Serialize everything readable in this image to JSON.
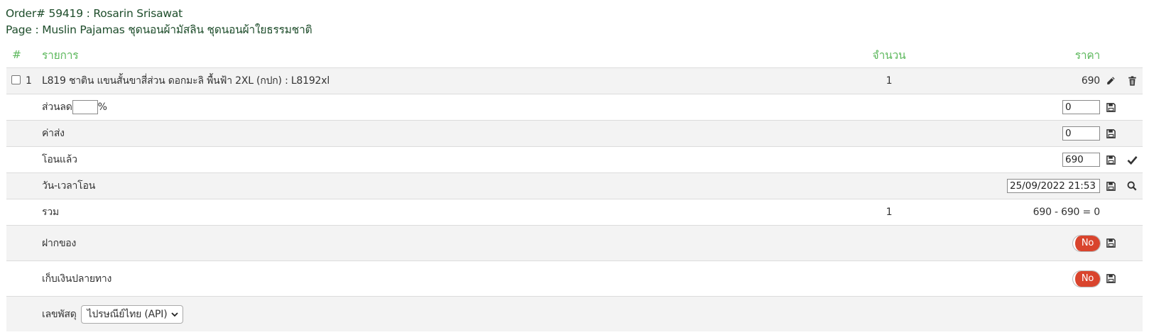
{
  "header": {
    "order_line": "Order# 59419 : Rosarin Srisawat",
    "page_line": "Page : Muslin Pajamas ชุดนอนผ้ามัสลิน ชุดนอนผ้าใยธรรมชาติ"
  },
  "columns": {
    "num": "#",
    "item": "รายการ",
    "qty": "จำนวน",
    "price": "ราคา"
  },
  "item": {
    "number": "1",
    "name": "L819 ชาติน แขนสั้นขาสี่ส่วน ดอกมะลิ พื้นฟ้า 2XL (กปก) : L8192xl",
    "qty": "1",
    "price": "690"
  },
  "discount": {
    "label": "ส่วนลด",
    "value": "",
    "unit": "%",
    "amount": "0"
  },
  "shipping": {
    "label": "ค่าส่ง",
    "value": "0"
  },
  "transferred": {
    "label": "โอนแล้ว",
    "value": "690"
  },
  "transfer_datetime": {
    "label": "วัน-เวลาโอน",
    "value": "25/09/2022 21:53"
  },
  "total": {
    "label": "รวม",
    "qty": "1",
    "formula": "690 - 690 = 0"
  },
  "deposit": {
    "label": "ฝากของ",
    "toggle": "No"
  },
  "cod": {
    "label": "เก็บเงินปลายทาง",
    "toggle": "No"
  },
  "tracking": {
    "label": "เลขพัสดุ",
    "carrier_selected": "ไปรษณีย์ไทย (API)"
  },
  "colors": {
    "header_text": "#1e4d2b",
    "column_header": "#5cb85c",
    "toggle_off": "#d9442d",
    "row_alt": "#f3f3f3"
  },
  "icons": [
    "pencil-icon",
    "trash-icon",
    "save-icon",
    "check-icon",
    "search-icon",
    "chevron-down-icon"
  ]
}
